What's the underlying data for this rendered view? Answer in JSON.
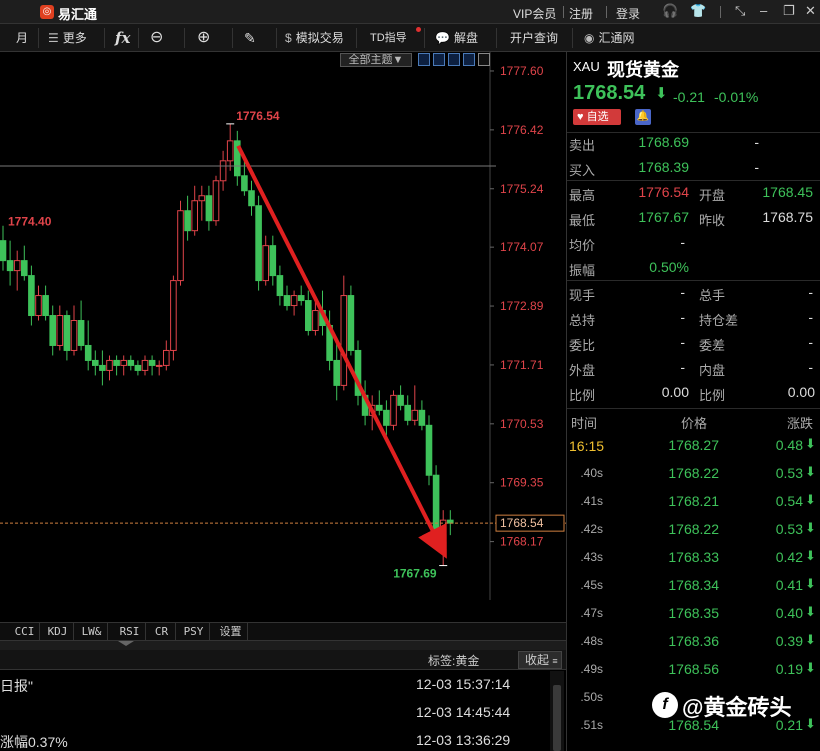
{
  "app": {
    "title": "易汇通",
    "vip_label": "VIP会员",
    "register_label": "注册",
    "login_label": "登录"
  },
  "toolbar": {
    "month_label": "月",
    "more_label": "更多",
    "fx_label": "fx",
    "sim_trade_label": "模拟交易",
    "td_label": "TD指导",
    "analysis_label": "解盘",
    "open_account_label": "开户查询",
    "site_label": "汇通网"
  },
  "chart": {
    "theme_label": "全部主题▼",
    "y_ticks": [
      "1777.60",
      "1776.42",
      "1775.24",
      "1774.07",
      "1772.89",
      "1771.71",
      "1770.53",
      "1769.35",
      "1768.17"
    ],
    "current_price_label": "1768.54",
    "high_annotation": "1776.54",
    "low_annotation": "1767.69",
    "left_annotation": "1774.40",
    "up_color": "#e0444a",
    "down_color": "#3ec25a"
  },
  "chart_data": {
    "type": "candlestick",
    "ylim": [
      1767.0,
      1777.9
    ],
    "candles": [
      {
        "o": 1774.2,
        "h": 1774.5,
        "l": 1773.6,
        "c": 1773.8
      },
      {
        "o": 1773.8,
        "h": 1774.2,
        "l": 1773.3,
        "c": 1773.6
      },
      {
        "o": 1773.6,
        "h": 1774.0,
        "l": 1773.2,
        "c": 1773.8
      },
      {
        "o": 1773.8,
        "h": 1774.1,
        "l": 1773.4,
        "c": 1773.5
      },
      {
        "o": 1773.5,
        "h": 1773.7,
        "l": 1772.5,
        "c": 1772.7
      },
      {
        "o": 1772.7,
        "h": 1773.3,
        "l": 1772.6,
        "c": 1773.1
      },
      {
        "o": 1773.1,
        "h": 1773.3,
        "l": 1772.6,
        "c": 1772.7
      },
      {
        "o": 1772.7,
        "h": 1772.9,
        "l": 1771.9,
        "c": 1772.1
      },
      {
        "o": 1772.1,
        "h": 1772.9,
        "l": 1772.0,
        "c": 1772.7
      },
      {
        "o": 1772.7,
        "h": 1772.8,
        "l": 1771.8,
        "c": 1772.0
      },
      {
        "o": 1772.0,
        "h": 1772.9,
        "l": 1771.9,
        "c": 1772.6
      },
      {
        "o": 1772.6,
        "h": 1773.0,
        "l": 1772.0,
        "c": 1772.1
      },
      {
        "o": 1772.1,
        "h": 1772.6,
        "l": 1771.6,
        "c": 1771.8
      },
      {
        "o": 1771.8,
        "h": 1772.0,
        "l": 1771.5,
        "c": 1771.7
      },
      {
        "o": 1771.7,
        "h": 1772.0,
        "l": 1771.3,
        "c": 1771.6
      },
      {
        "o": 1771.6,
        "h": 1771.9,
        "l": 1771.4,
        "c": 1771.8
      },
      {
        "o": 1771.8,
        "h": 1771.9,
        "l": 1771.5,
        "c": 1771.7
      },
      {
        "o": 1771.7,
        "h": 1771.9,
        "l": 1771.5,
        "c": 1771.8
      },
      {
        "o": 1771.8,
        "h": 1771.9,
        "l": 1771.6,
        "c": 1771.7
      },
      {
        "o": 1771.7,
        "h": 1771.8,
        "l": 1771.5,
        "c": 1771.6
      },
      {
        "o": 1771.6,
        "h": 1771.9,
        "l": 1771.5,
        "c": 1771.8
      },
      {
        "o": 1771.8,
        "h": 1771.9,
        "l": 1771.5,
        "c": 1771.7
      },
      {
        "o": 1771.7,
        "h": 1771.8,
        "l": 1771.5,
        "c": 1771.7
      },
      {
        "o": 1771.7,
        "h": 1772.2,
        "l": 1771.6,
        "c": 1772.0
      },
      {
        "o": 1772.0,
        "h": 1773.5,
        "l": 1771.8,
        "c": 1773.4
      },
      {
        "o": 1773.4,
        "h": 1775.0,
        "l": 1773.3,
        "c": 1774.8
      },
      {
        "o": 1774.8,
        "h": 1775.1,
        "l": 1774.2,
        "c": 1774.4
      },
      {
        "o": 1774.4,
        "h": 1775.3,
        "l": 1774.3,
        "c": 1775.0
      },
      {
        "o": 1775.0,
        "h": 1775.3,
        "l": 1774.6,
        "c": 1775.1
      },
      {
        "o": 1775.1,
        "h": 1775.3,
        "l": 1774.4,
        "c": 1774.6
      },
      {
        "o": 1774.6,
        "h": 1775.5,
        "l": 1774.5,
        "c": 1775.4
      },
      {
        "o": 1775.4,
        "h": 1776.0,
        "l": 1775.2,
        "c": 1775.8
      },
      {
        "o": 1775.8,
        "h": 1776.54,
        "l": 1775.6,
        "c": 1776.2
      },
      {
        "o": 1776.2,
        "h": 1776.4,
        "l": 1775.3,
        "c": 1775.5
      },
      {
        "o": 1775.5,
        "h": 1775.9,
        "l": 1775.1,
        "c": 1775.2
      },
      {
        "o": 1775.2,
        "h": 1775.4,
        "l": 1774.7,
        "c": 1774.9
      },
      {
        "o": 1774.9,
        "h": 1775.1,
        "l": 1773.2,
        "c": 1773.4
      },
      {
        "o": 1773.4,
        "h": 1774.3,
        "l": 1773.3,
        "c": 1774.1
      },
      {
        "o": 1774.1,
        "h": 1774.3,
        "l": 1773.3,
        "c": 1773.5
      },
      {
        "o": 1773.5,
        "h": 1773.7,
        "l": 1772.9,
        "c": 1773.1
      },
      {
        "o": 1773.1,
        "h": 1773.3,
        "l": 1772.8,
        "c": 1772.9
      },
      {
        "o": 1772.9,
        "h": 1773.2,
        "l": 1772.7,
        "c": 1773.1
      },
      {
        "o": 1773.1,
        "h": 1773.3,
        "l": 1772.9,
        "c": 1773.0
      },
      {
        "o": 1773.0,
        "h": 1773.2,
        "l": 1772.3,
        "c": 1772.4
      },
      {
        "o": 1772.4,
        "h": 1773.0,
        "l": 1772.3,
        "c": 1772.8
      },
      {
        "o": 1772.8,
        "h": 1773.2,
        "l": 1772.3,
        "c": 1772.5
      },
      {
        "o": 1772.5,
        "h": 1772.8,
        "l": 1771.6,
        "c": 1771.8
      },
      {
        "o": 1771.8,
        "h": 1772.2,
        "l": 1771.0,
        "c": 1771.3
      },
      {
        "o": 1771.3,
        "h": 1773.5,
        "l": 1771.2,
        "c": 1773.1
      },
      {
        "o": 1773.1,
        "h": 1773.3,
        "l": 1771.9,
        "c": 1772.0
      },
      {
        "o": 1772.0,
        "h": 1772.2,
        "l": 1770.9,
        "c": 1771.1
      },
      {
        "o": 1771.1,
        "h": 1771.4,
        "l": 1770.5,
        "c": 1770.7
      },
      {
        "o": 1770.7,
        "h": 1771.1,
        "l": 1770.4,
        "c": 1770.9
      },
      {
        "o": 1770.9,
        "h": 1771.2,
        "l": 1770.7,
        "c": 1770.8
      },
      {
        "o": 1770.8,
        "h": 1771.0,
        "l": 1770.3,
        "c": 1770.5
      },
      {
        "o": 1770.5,
        "h": 1771.2,
        "l": 1770.4,
        "c": 1771.1
      },
      {
        "o": 1771.1,
        "h": 1771.3,
        "l": 1770.8,
        "c": 1770.9
      },
      {
        "o": 1770.9,
        "h": 1771.1,
        "l": 1770.5,
        "c": 1770.6
      },
      {
        "o": 1770.6,
        "h": 1771.3,
        "l": 1770.5,
        "c": 1770.8
      },
      {
        "o": 1770.8,
        "h": 1771.0,
        "l": 1770.4,
        "c": 1770.5
      },
      {
        "o": 1770.5,
        "h": 1770.7,
        "l": 1769.3,
        "c": 1769.5
      },
      {
        "o": 1769.5,
        "h": 1769.7,
        "l": 1768.1,
        "c": 1768.3
      },
      {
        "o": 1768.3,
        "h": 1768.8,
        "l": 1767.69,
        "c": 1768.6
      },
      {
        "o": 1768.6,
        "h": 1768.8,
        "l": 1768.3,
        "c": 1768.54
      }
    ]
  },
  "indicators": [
    "CCI",
    "KDJ",
    "LW&",
    "RSI",
    "CR",
    "PSY",
    "设置"
  ],
  "news": {
    "tag_label": "标签:黄金",
    "collapse_label": "收起",
    "items": [
      {
        "title": "日报\"",
        "time": "12-03 15:37:14"
      },
      {
        "title": "",
        "time": "12-03 14:45:44"
      },
      {
        "title": "涨幅0.37%",
        "time": "12-03 13:36:29"
      }
    ]
  },
  "quote": {
    "code": "XAU",
    "name": "现货黄金",
    "price": "1768.54",
    "arrow": "⬇",
    "change": "-0.21",
    "change_pct": "-0.01%",
    "fav_label": "♥ 自选",
    "sell_label": "卖出",
    "sell_value": "1768.69",
    "sell_extra": "-",
    "buy_label": "买入",
    "buy_value": "1768.39",
    "buy_extra": "-",
    "high_label": "最高",
    "high_value": "1776.54",
    "open_label": "开盘",
    "open_value": "1768.45",
    "low_label": "最低",
    "low_value": "1767.67",
    "prev_label": "昨收",
    "prev_value": "1768.75",
    "avg_label": "均价",
    "avg_value": "-",
    "amp_label": "振幅",
    "amp_value": "0.50%",
    "hand_label": "现手",
    "hand_value": "-",
    "total_hand_label": "总手",
    "total_hand_value": "-",
    "hold_label": "总持",
    "hold_value": "-",
    "hold_diff_label": "持仓差",
    "hold_diff_value": "-",
    "ratio_label": "委比",
    "ratio_value": "-",
    "ratio_diff_label": "委差",
    "ratio_diff_value": "-",
    "outer_label": "外盘",
    "outer_value": "-",
    "inner_label": "内盘",
    "inner_value": "-",
    "pct1_label": "比例",
    "pct1_value": "0.00",
    "pct2_label": "比例",
    "pct2_value": "0.00"
  },
  "ticks": {
    "time_header": "时间",
    "price_header": "价格",
    "chg_header": "涨跌",
    "rows": [
      {
        "time": "16:15",
        "price": "1768.27",
        "chg": "0.48"
      },
      {
        "time": ".40s",
        "price": "1768.22",
        "chg": "0.53"
      },
      {
        "time": ".41s",
        "price": "1768.21",
        "chg": "0.54"
      },
      {
        "time": ".42s",
        "price": "1768.22",
        "chg": "0.53"
      },
      {
        "time": ".43s",
        "price": "1768.33",
        "chg": "0.42"
      },
      {
        "time": ".45s",
        "price": "1768.34",
        "chg": "0.41"
      },
      {
        "time": ".47s",
        "price": "1768.35",
        "chg": "0.40"
      },
      {
        "time": ".48s",
        "price": "1768.36",
        "chg": "0.39"
      },
      {
        "time": ".49s",
        "price": "1768.56",
        "chg": "0.19"
      },
      {
        "time": ".50s",
        "price": "",
        "chg": ""
      },
      {
        "time": ".51s",
        "price": "1768.54",
        "chg": "0.21"
      }
    ]
  },
  "watermark": "@黄金砖头"
}
